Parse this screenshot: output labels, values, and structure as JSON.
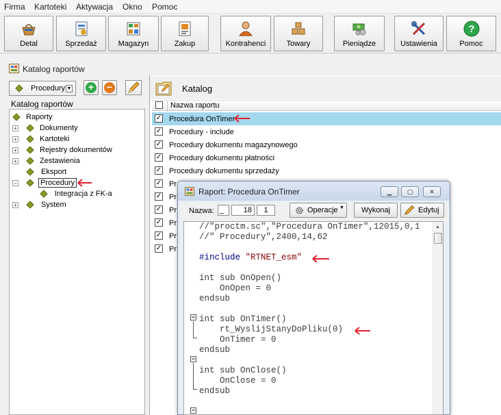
{
  "menu": [
    "Firma",
    "Kartoteki",
    "Aktywacja",
    "Okno",
    "Pomoc"
  ],
  "toolbar": {
    "buttons": [
      {
        "label": "Detal",
        "icon": "basket-icon"
      },
      {
        "label": "Sprzedaż",
        "icon": "sales-icon"
      },
      {
        "label": "Magazyn",
        "icon": "warehouse-icon"
      },
      {
        "label": "Zakup",
        "icon": "purchase-icon"
      },
      {
        "label": "Kontrahenci",
        "icon": "person-icon"
      },
      {
        "label": "Towary",
        "icon": "boxes-icon"
      },
      {
        "label": "Pieniądze",
        "icon": "money-icon"
      },
      {
        "label": "Ustawienia",
        "icon": "tools-icon"
      },
      {
        "label": "Pomoc",
        "icon": "help-icon"
      }
    ]
  },
  "left_pane": {
    "title": "Katalog raportów",
    "dropdown_value": "Procedury",
    "tree_label": "Katalog raportów",
    "tree": {
      "root": "Raporty",
      "items": [
        "Dokumenty",
        "Kartoteki",
        "Rejestry dokumentów",
        "Zestawienia",
        "Eksport",
        "Procedury",
        "System"
      ],
      "child": "Integracja z FK-a"
    }
  },
  "right_pane": {
    "title": "Katalog",
    "column_header": "Nazwa raportu",
    "rows": [
      "Procedura OnTimer",
      "Procedury - include",
      "Procedury dokumentu magazynowego",
      "Procedury dokumentu płatności",
      "Procedury dokumentu sprzedaży",
      "Pr",
      "Pr",
      "Pr",
      "Pr",
      "Pr",
      "Pr"
    ]
  },
  "dialog": {
    "title": "Raport: Procedura OnTimer",
    "nazwa_label": "Nazwa:",
    "field_a": "_",
    "field_b": "18",
    "field_c": "1",
    "operacje_label": "Operacje",
    "wykonaj_label": "Wykonaj",
    "edytuj_label": "Edytuj",
    "code": [
      "//\"proctm.sc\",\"Procedura OnTimer\",12015,0,1",
      "//\" Procedury\",2400,14,62",
      "",
      "#include \"RTNET_esm\"",
      "",
      "int sub OnOpen()",
      "    OnOpen = 0",
      "endsub",
      "",
      "int sub OnTimer()",
      "    rt_WyslijStanyDoPliku(0)",
      "    OnTimer = 0",
      "endsub",
      "",
      "int sub OnClose()",
      "    OnClose = 0",
      "endsub"
    ]
  },
  "colors": {
    "selection": "#a3d8ef",
    "arrow": "#e0202a",
    "keyword": "#000080"
  }
}
